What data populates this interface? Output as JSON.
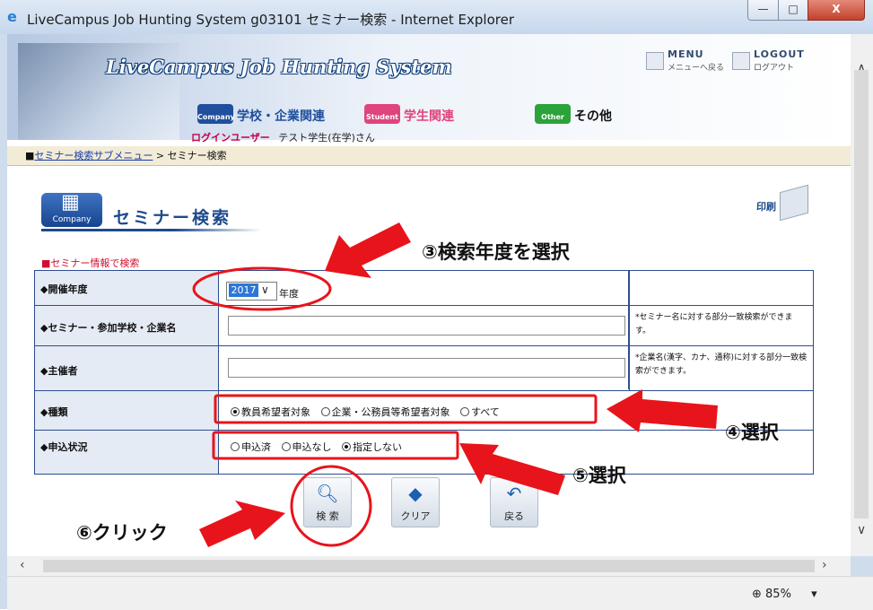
{
  "window": {
    "title": "LiveCampus Job Hunting System g03101 セミナー検索 - Internet Explorer",
    "controls": {
      "minimize": "—",
      "maximize": "□",
      "close": "X"
    }
  },
  "header": {
    "logo": "LiveCampus Job Hunting System",
    "menu_link": {
      "main": "MENU",
      "sub": "メニューへ戻る"
    },
    "logout_link": {
      "main": "LOGOUT",
      "sub": "ログアウト"
    },
    "categories": [
      {
        "badge": "Company",
        "label": "学校・企業関連",
        "color": "#1f4f9d"
      },
      {
        "badge": "Student",
        "label": "学生関連",
        "color": "#e0447c"
      },
      {
        "badge": "Other",
        "label": "その他",
        "color": "#2aa33a"
      }
    ],
    "login_label": "ログインユーザー",
    "login_user": "テスト学生(在学)さん"
  },
  "breadcrumb": {
    "prefix": "■",
    "link": "セミナー検索サブメニュー",
    "separator": " > ",
    "current": "セミナー検索"
  },
  "page": {
    "badge": "Company",
    "title": "セミナー検索",
    "print_label": "印刷",
    "section_label": "■セミナー情報で検索"
  },
  "form": {
    "year": {
      "label": "◆開催年度",
      "value": "2017",
      "suffix": "年度"
    },
    "name": {
      "label": "◆セミナー・参加学校・企業名",
      "value": "",
      "note": "*セミナー名に対する部分一致検索ができます。"
    },
    "organizer": {
      "label": "◆主催者",
      "value": "",
      "note": "*企業名(漢字、カナ、通称)に対する部分一致検索ができます。"
    },
    "kind": {
      "label": "◆種類",
      "options": [
        "教員希望者対象",
        "企業・公務員等希望者対象",
        "すべて"
      ],
      "selected": 0
    },
    "status": {
      "label": "◆申込状況",
      "options": [
        "申込済",
        "申込なし",
        "指定しない"
      ],
      "selected": 2
    }
  },
  "actions": {
    "search": "検 索",
    "clear": "クリア",
    "back": "戻る"
  },
  "annotations": {
    "step3": "③検索年度を選択",
    "step4": "④選択",
    "step5": "⑤選択",
    "step6": "⑥クリック",
    "color": "#e8141b"
  },
  "statusbar": {
    "zoom": "85%"
  }
}
